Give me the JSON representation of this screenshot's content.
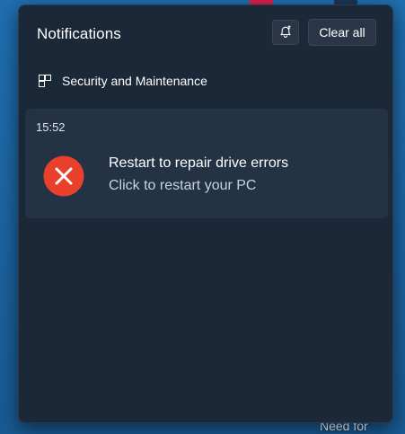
{
  "panel": {
    "title": "Notifications",
    "clear_all_label": "Clear all",
    "dnd_icon": "bell-snooze-icon"
  },
  "group": {
    "app_name": "Security and Maintenance",
    "app_icon": "security-maintenance-icon"
  },
  "notification": {
    "time": "15:52",
    "title": "Restart to repair drive errors",
    "body": "Click to restart your PC",
    "icon": "error-icon",
    "icon_color": "#e8402a"
  },
  "background": {
    "partial_text": "Need for"
  }
}
